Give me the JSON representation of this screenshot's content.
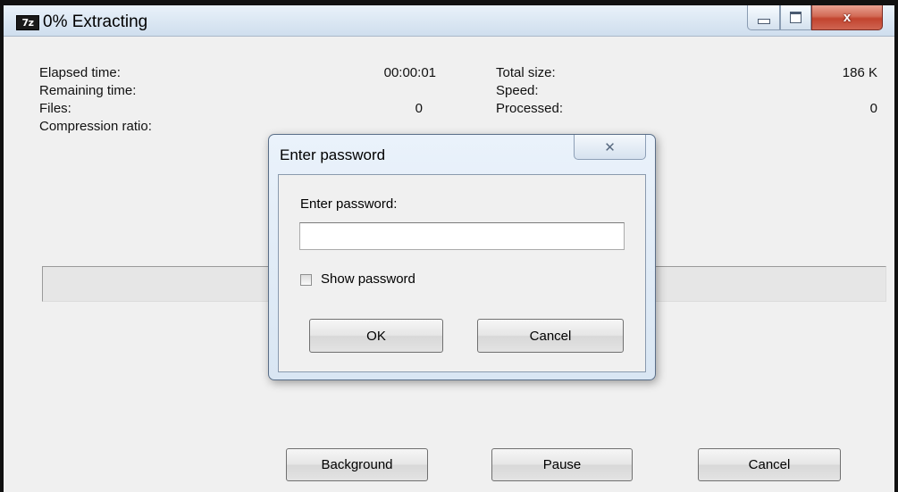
{
  "window": {
    "title": "0% Extracting",
    "app_icon_text": "7z",
    "icons": [
      "minimize-icon",
      "maximize-icon",
      "close-icon"
    ],
    "close_glyph": "x"
  },
  "stats": {
    "elapsed_time_label": "Elapsed time:",
    "elapsed_time_value": "00:00:01",
    "remaining_time_label": "Remaining time:",
    "files_label": "Files:",
    "files_value": "0",
    "compression_ratio_label": "Compression ratio:",
    "total_size_label": "Total size:",
    "total_size_value": "186 K",
    "speed_label": "Speed:",
    "processed_label": "Processed:",
    "processed_value": "0"
  },
  "progress": {
    "percent": 0,
    "fill_color": "#37c337"
  },
  "buttons": {
    "background": "Background",
    "pause": "Pause",
    "cancel": "Cancel"
  },
  "password_dialog": {
    "title": "Enter password",
    "close_glyph": "✕",
    "prompt": "Enter password:",
    "password_value": "",
    "show_password_label": "Show password",
    "show_password_checked": false,
    "ok": "OK",
    "cancel": "Cancel"
  }
}
